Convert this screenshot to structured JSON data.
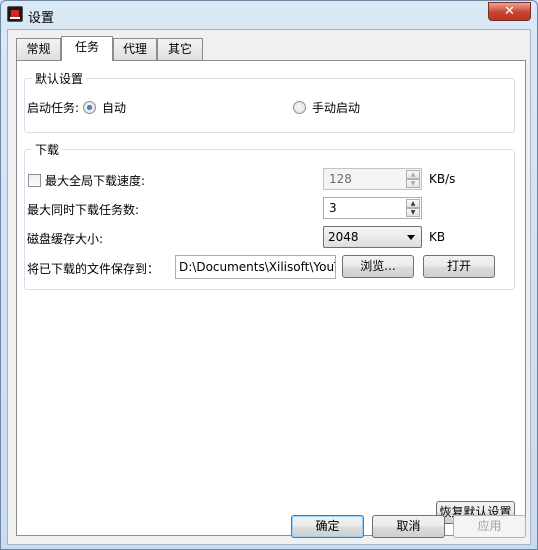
{
  "window": {
    "title": "设置",
    "close_label": "✕"
  },
  "tabs": [
    {
      "label": "常规",
      "active": false
    },
    {
      "label": "任务",
      "active": true
    },
    {
      "label": "代理",
      "active": false
    },
    {
      "label": "其它",
      "active": false
    }
  ],
  "default_settings": {
    "group_label": "默认设置",
    "startup_task_label": "启动任务:",
    "auto_label": "自动",
    "manual_label": "手动启动",
    "selected": "auto"
  },
  "download": {
    "group_label": "下载",
    "max_speed": {
      "label": "最大全局下载速度:",
      "checked": false,
      "value": "128",
      "unit": "KB/s"
    },
    "max_tasks": {
      "label": "最大同时下载任务数:",
      "value": "3"
    },
    "disk_cache": {
      "label": "磁盘缓存大小:",
      "value": "2048",
      "unit": "KB"
    },
    "save_path": {
      "label": "将已下载的文件保存到：",
      "value": "D:\\Documents\\Xilisoft\\YouT",
      "browse_label": "浏览...",
      "open_label": "打开"
    }
  },
  "restore_defaults_label": "恢复默认设置",
  "buttons": {
    "ok_label": "确定",
    "cancel_label": "取消",
    "apply_label": "应用"
  }
}
